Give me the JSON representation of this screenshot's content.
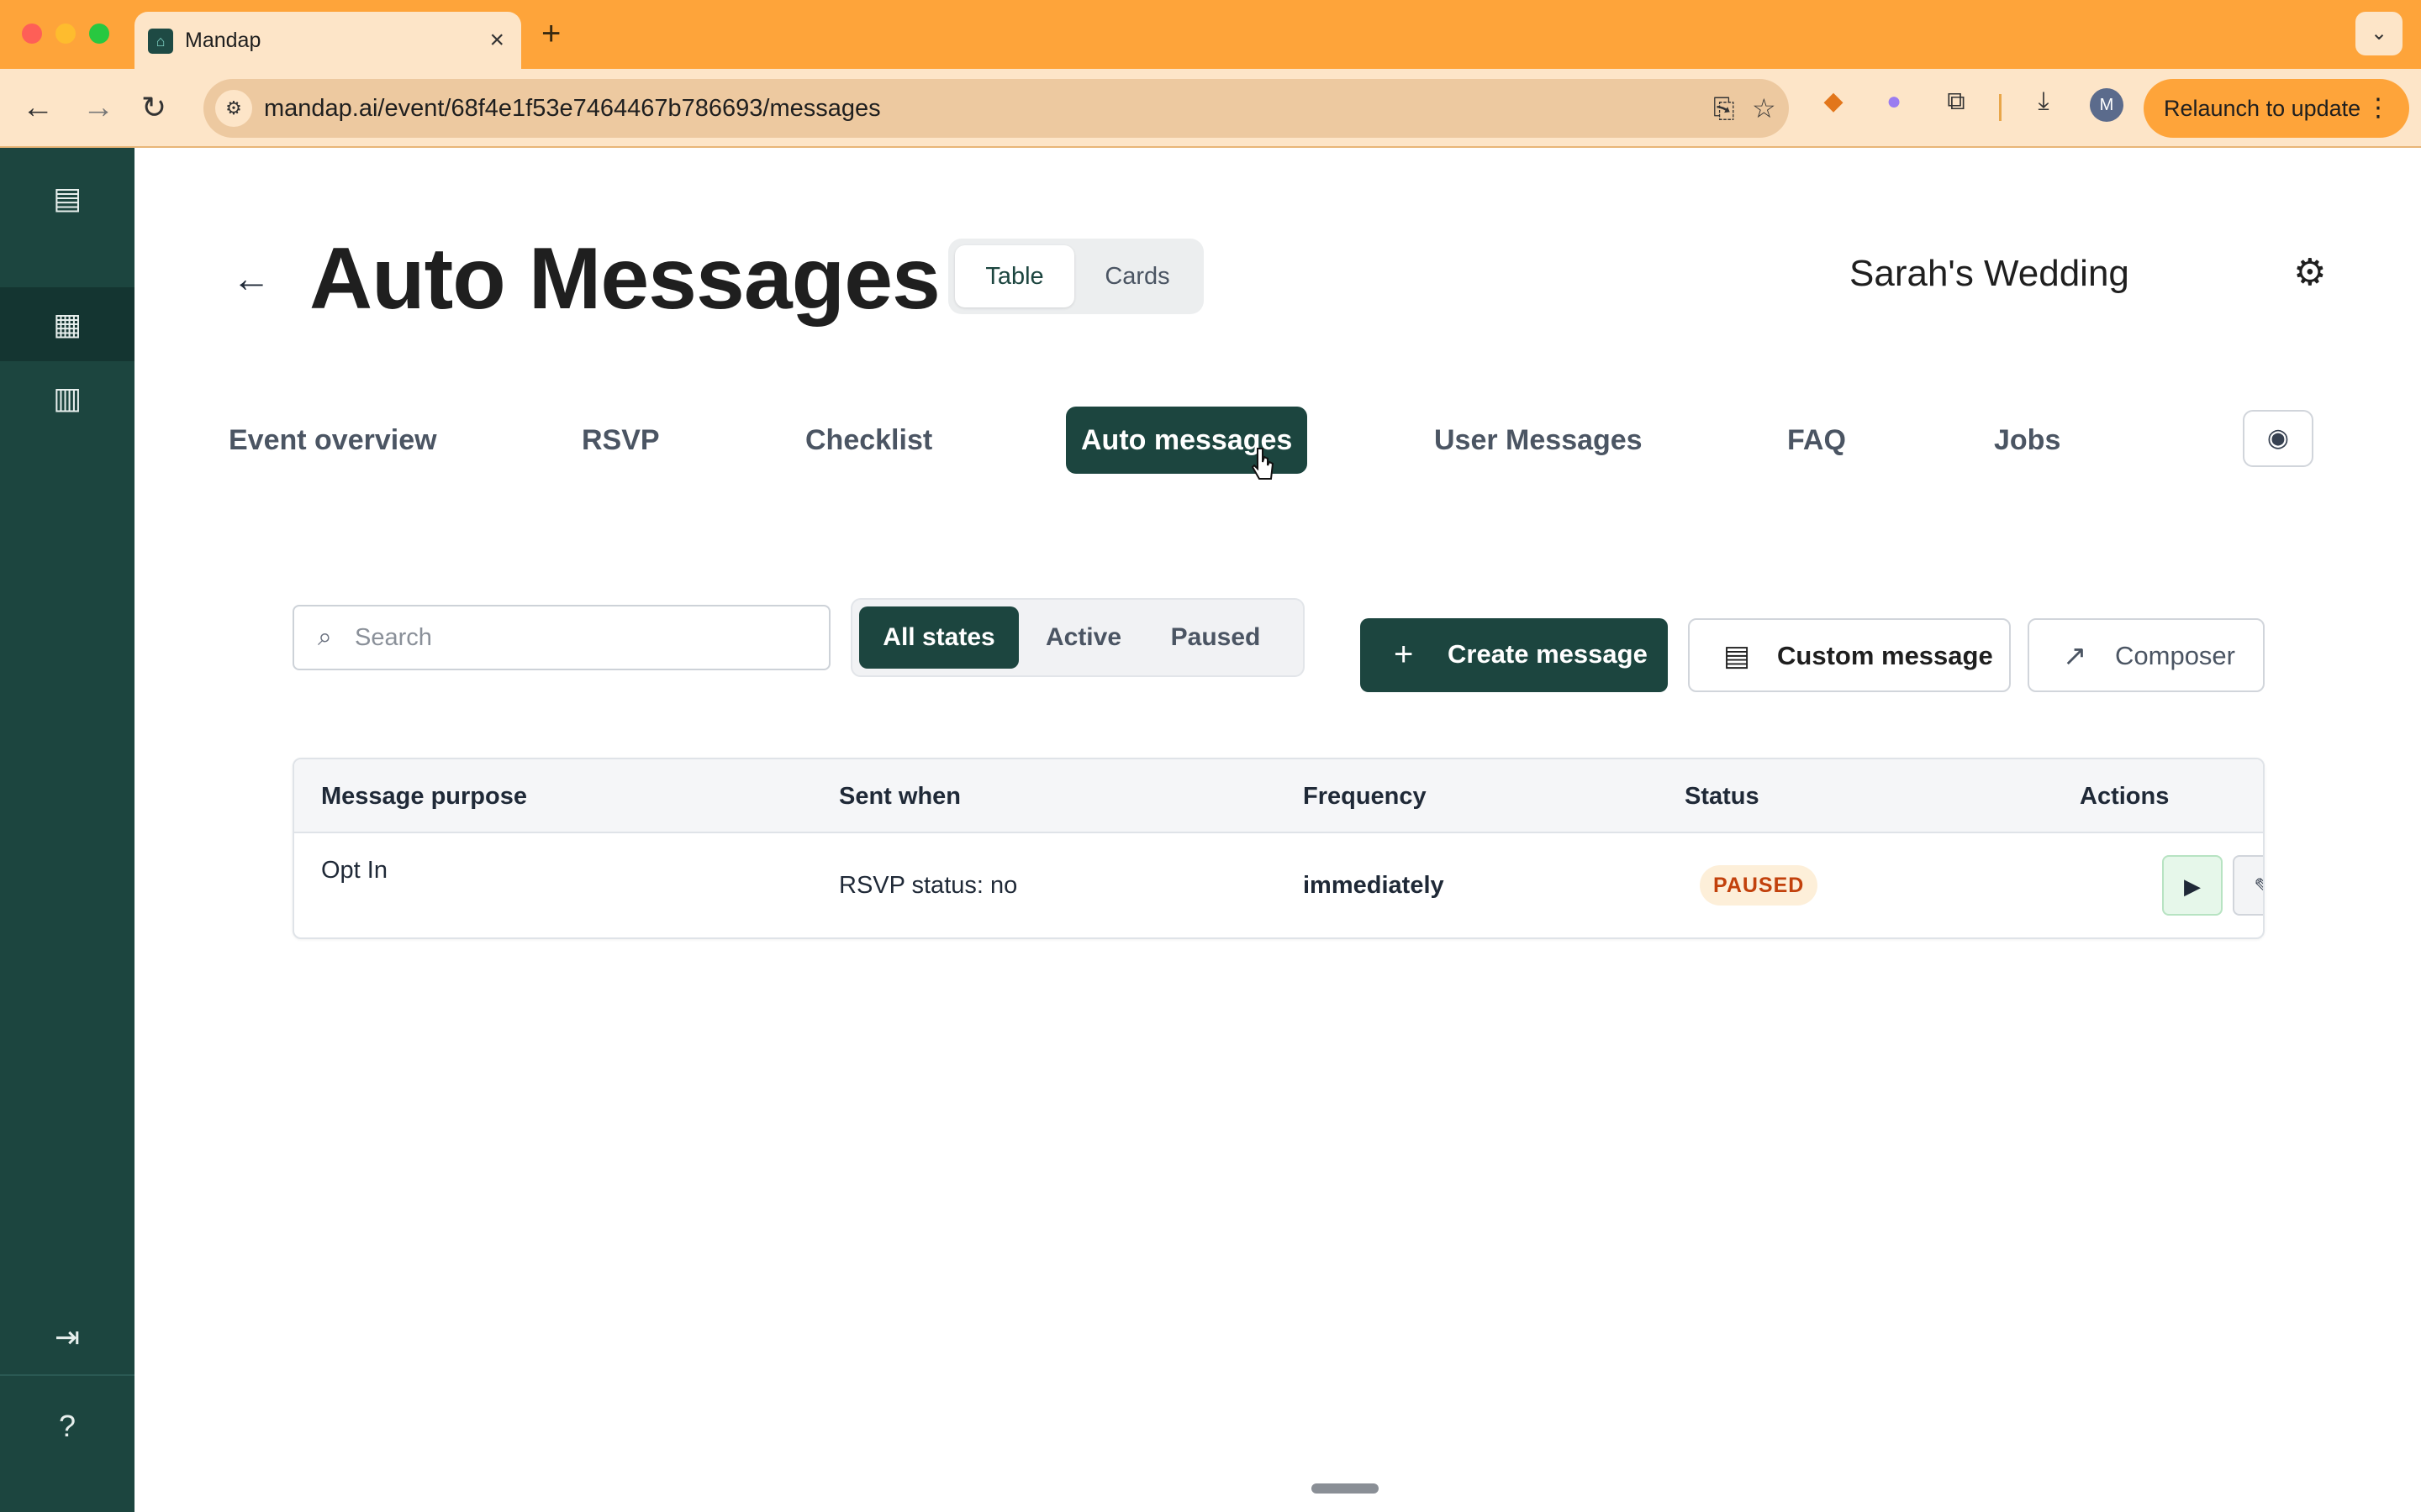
{
  "browser": {
    "tab_title": "Mandap",
    "url": "mandap.ai/event/68f4e1f53e7464467b786693/messages",
    "relaunch_label": "Relaunch to update",
    "profile_initial": "M"
  },
  "header": {
    "title": "Auto Messages",
    "view_toggle": [
      "Table",
      "Cards"
    ],
    "event_name": "Sarah's Wedding"
  },
  "nav_tabs": [
    "Event overview",
    "RSVP",
    "Checklist",
    "Auto messages",
    "User Messages",
    "FAQ",
    "Jobs"
  ],
  "active_nav_tab": "Auto messages",
  "toolbar": {
    "search_placeholder": "Search",
    "state_filters": [
      "All states",
      "Active",
      "Paused"
    ],
    "active_state_filter": "All states",
    "create_label": "Create message",
    "custom_label": "Custom message",
    "composer_label": "Composer"
  },
  "table": {
    "columns": [
      "Message purpose",
      "Sent when",
      "Frequency",
      "Status",
      "Actions"
    ],
    "rows": [
      {
        "purpose": "Opt In",
        "sent_when": "RSVP status: no",
        "frequency": "immediately",
        "status": "PAUSED"
      }
    ]
  },
  "colors": {
    "brand": "#1c453f",
    "browser_accent": "#fea43a",
    "status_paused_bg": "#fdefd9",
    "status_paused_text": "#c2410c",
    "delete": "#dc2626"
  },
  "icons": {
    "sidebar": [
      "sidebar-toggle-icon",
      "calendar-icon",
      "building-icon",
      "logout-icon",
      "help-icon"
    ],
    "actions": [
      "play-icon",
      "pencil-icon",
      "trash-icon"
    ]
  }
}
